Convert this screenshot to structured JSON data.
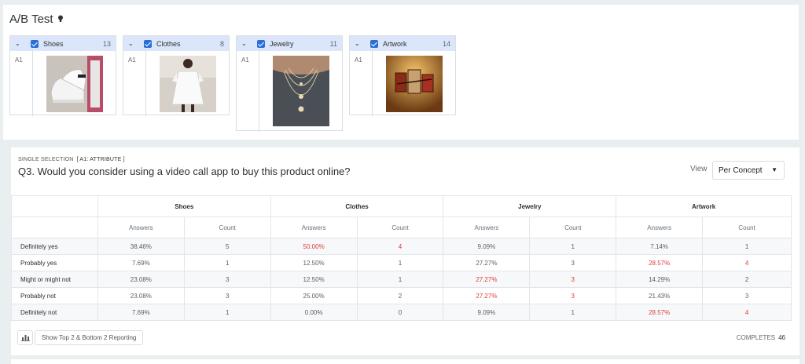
{
  "page": {
    "title": "A/B Test"
  },
  "concepts": [
    {
      "name": "Shoes",
      "count": "13",
      "attr": "A1",
      "icon": "shoes-image"
    },
    {
      "name": "Clothes",
      "count": "8",
      "attr": "A1",
      "icon": "dress-image"
    },
    {
      "name": "Jewelry",
      "count": "11",
      "attr": "A1",
      "icon": "necklace-image"
    },
    {
      "name": "Artwork",
      "count": "14",
      "attr": "A1",
      "icon": "painting-image"
    }
  ],
  "question": {
    "type": "SINGLE SELECTION",
    "attribute": "[ A1: ATTRIBUTE ]",
    "text": "Q3. Would you consider using a video call app to buy this product online?",
    "view_label": "View",
    "view_value": "Per Concept"
  },
  "table": {
    "groups": [
      "Shoes",
      "Clothes",
      "Jewelry",
      "Artwork"
    ],
    "sub_answers": "Answers",
    "sub_count": "Count",
    "rows": [
      {
        "label": "Definitely yes",
        "cells": [
          {
            "v": "38.46%"
          },
          {
            "v": "5"
          },
          {
            "v": "50.00%",
            "hl": true
          },
          {
            "v": "4",
            "hl": true
          },
          {
            "v": "9.09%"
          },
          {
            "v": "1"
          },
          {
            "v": "7.14%"
          },
          {
            "v": "1"
          }
        ]
      },
      {
        "label": "Probably yes",
        "cells": [
          {
            "v": "7.69%"
          },
          {
            "v": "1"
          },
          {
            "v": "12.50%"
          },
          {
            "v": "1"
          },
          {
            "v": "27.27%"
          },
          {
            "v": "3"
          },
          {
            "v": "28.57%",
            "hl": true
          },
          {
            "v": "4",
            "hl": true
          }
        ]
      },
      {
        "label": "Might or might not",
        "cells": [
          {
            "v": "23.08%"
          },
          {
            "v": "3"
          },
          {
            "v": "12.50%"
          },
          {
            "v": "1"
          },
          {
            "v": "27.27%",
            "hl": true
          },
          {
            "v": "3",
            "hl": true
          },
          {
            "v": "14.29%"
          },
          {
            "v": "2"
          }
        ]
      },
      {
        "label": "Probably not",
        "cells": [
          {
            "v": "23.08%"
          },
          {
            "v": "3"
          },
          {
            "v": "25.00%"
          },
          {
            "v": "2"
          },
          {
            "v": "27.27%",
            "hl": true
          },
          {
            "v": "3",
            "hl": true
          },
          {
            "v": "21.43%"
          },
          {
            "v": "3"
          }
        ]
      },
      {
        "label": "Definitely not",
        "cells": [
          {
            "v": "7.69%"
          },
          {
            "v": "1"
          },
          {
            "v": "0.00%"
          },
          {
            "v": "0"
          },
          {
            "v": "9.09%"
          },
          {
            "v": "1"
          },
          {
            "v": "28.57%",
            "hl": true
          },
          {
            "v": "4",
            "hl": true
          }
        ]
      }
    ]
  },
  "footer": {
    "report_button": "Show Top 2 & Bottom 2 Reporting",
    "completes_label": "COMPLETES",
    "completes_value": "46"
  },
  "colors": {
    "accent": "#2a6fd6",
    "highlight": "#e03b3b",
    "header_bg": "#dbe6fa"
  }
}
